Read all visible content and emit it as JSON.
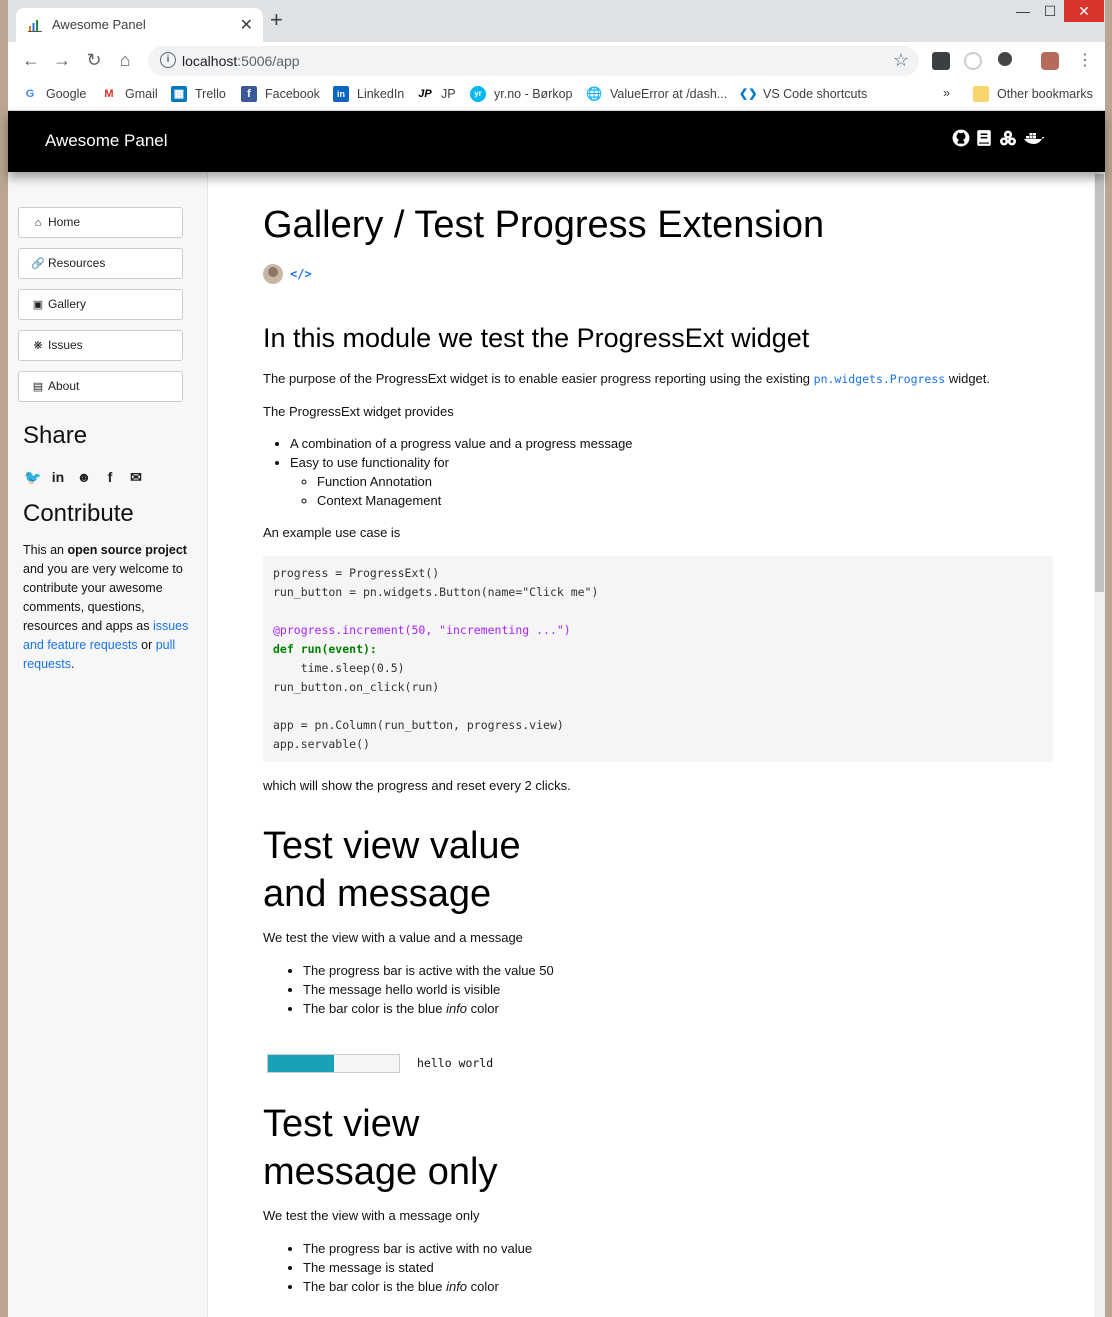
{
  "browser": {
    "tab_title": "Awesome Panel",
    "tab_close": "✕",
    "new_tab": "+",
    "url_host": "localhost",
    "url_rest": ":5006/app",
    "bookmarks": [
      "Google",
      "Gmail",
      "Trello",
      "Facebook",
      "LinkedIn",
      "JP",
      "yr.no - Børkop",
      "ValueError at /dash...",
      "VS Code shortcuts"
    ],
    "bookmarks_more": "»",
    "other_bookmarks": "Other bookmarks"
  },
  "app": {
    "title": "Awesome Panel",
    "header_icons": [
      "github-icon",
      "book-icon",
      "cubes-icon",
      "docker-icon"
    ]
  },
  "sidebar": {
    "nav": [
      {
        "label": "Home",
        "icon": "home-icon"
      },
      {
        "label": "Resources",
        "icon": "link-icon"
      },
      {
        "label": "Gallery",
        "icon": "images-icon"
      },
      {
        "label": "Issues",
        "icon": "bug-icon"
      },
      {
        "label": "About",
        "icon": "id-card-icon"
      }
    ],
    "share_heading": "Share",
    "share_icons": [
      "twitter-icon",
      "linkedin-icon",
      "reddit-icon",
      "facebook-icon",
      "envelope-icon"
    ],
    "contribute_heading": "Contribute",
    "contribute": {
      "t1": "This an ",
      "b1": "open source project",
      "t2": " and you are very welcome to contribute your awesome comments, questions, resources and apps as ",
      "link1": "issues and feature requests",
      "t3": " or ",
      "link2": "pull requests",
      "t4": "."
    }
  },
  "main": {
    "title": "Gallery / Test Progress Extension",
    "h2": "In this module we test the ProgressExt widget",
    "p1_a": "The purpose of the ProgressExt widget is to enable easier progress reporting using the existing ",
    "p1_code": "pn.widgets.Progress",
    "p1_b": " widget.",
    "p2": "The ProgressExt widget provides",
    "list1": [
      "A combination of a progress value and a progress message",
      "Easy to use functionality for"
    ],
    "sublist1": [
      "Function Annotation",
      "Context Management"
    ],
    "p3": "An example use case is",
    "code_lines": [
      "progress = ProgressExt()",
      "run_button = pn.widgets.Button(name=\"Click me\")",
      "",
      "@progress.increment(50, \"incrementing ...\")",
      "def run(event):",
      "    time.sleep(0.5)",
      "run_button.on_click(run)",
      "",
      "app = pn.Column(run_button, progress.view)",
      "app.servable()"
    ],
    "p4": "which will show the progress and reset every 2 clicks.",
    "s1_title_1": "Test view value",
    "s1_title_2": "and message",
    "s1_p": "We test the view with a value and a message",
    "s1_list": [
      "The progress bar is active with the value 50",
      "The message hello world is visible"
    ],
    "s1_list3_a": "The bar color is the blue ",
    "s1_list3_em": "info",
    "s1_list3_b": " color",
    "progress_value": 0.5,
    "progress_color": "#17a2b8",
    "progress_message": "hello world",
    "s2_title_1": "Test view",
    "s2_title_2": "message only",
    "s2_p": "We test the view with a message only",
    "s2_list": [
      "The progress bar is active with no value",
      "The message is stated"
    ],
    "s2_list3_a": "The bar color is the blue ",
    "s2_list3_em": "info",
    "s2_list3_b": " color"
  }
}
